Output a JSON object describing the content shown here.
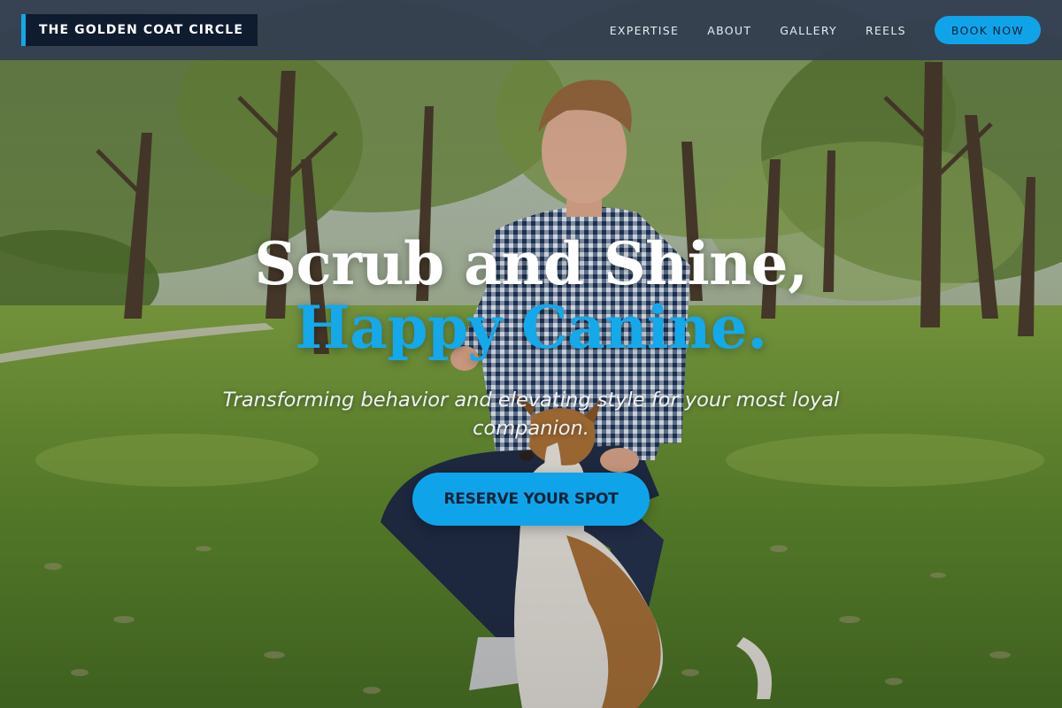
{
  "brand": {
    "name": "THE GOLDEN COAT CIRCLE"
  },
  "nav": {
    "links": [
      {
        "label": "EXPERTISE"
      },
      {
        "label": "ABOUT"
      },
      {
        "label": "GALLERY"
      },
      {
        "label": "REELS"
      }
    ],
    "cta_label": "BOOK NOW"
  },
  "hero": {
    "title_part1": "Scrub and Shine, ",
    "title_accent": "Happy Canine.",
    "subtitle": "Transforming behavior and elevating style for your most loyal companion.",
    "cta_label": "RESERVE YOUR SPOT",
    "background_image": "man-kneeling-with-dog-in-park"
  },
  "colors": {
    "accent": "#13a9eb",
    "nav_bg": "#343f4e",
    "brand_bg": "#0f1b2e"
  }
}
